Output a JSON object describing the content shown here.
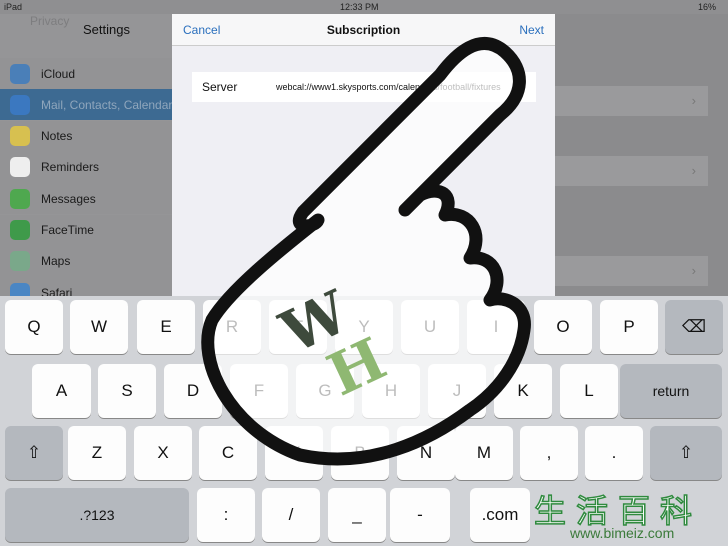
{
  "status": {
    "device": "iPad",
    "time": "12:33 PM",
    "battery": "16%"
  },
  "sidebar": {
    "title": "Settings",
    "ghost": "Privacy",
    "items": [
      {
        "label": "iCloud",
        "color": "#4a7fb8"
      },
      {
        "label": "Mail, Contacts, Calendars",
        "color": "#3b78c0"
      },
      {
        "label": "Notes",
        "color": "#d7c050"
      },
      {
        "label": "Reminders",
        "color": "#eeeeee"
      },
      {
        "label": "Messages",
        "color": "#4fa84f"
      },
      {
        "label": "FaceTime",
        "color": "#3f9a4a"
      },
      {
        "label": "Maps",
        "color": "#7aa88a"
      },
      {
        "label": "Safari",
        "color": "#4a86c4"
      }
    ]
  },
  "modal": {
    "cancel": "Cancel",
    "title": "Subscription",
    "next": "Next",
    "server_label": "Server",
    "server_value": "webcal://www1.skysports.com/calendars/football/fixtures"
  },
  "keyboard": {
    "rows": [
      [
        "Q",
        "W",
        "E",
        "R",
        "T",
        "Y",
        "U",
        "I",
        "O",
        "P",
        "⌫"
      ],
      [
        "A",
        "S",
        "D",
        "F",
        "G",
        "H",
        "J",
        "K",
        "L",
        "return"
      ],
      [
        "⇧",
        "Z",
        "X",
        "C",
        "V",
        "B",
        "N",
        "M",
        ",",
        ".",
        "⇧"
      ],
      [
        ".?123",
        ":",
        "/",
        "_",
        "-",
        ".com"
      ]
    ]
  },
  "overlay": {
    "logo": "WH",
    "watermark_cn": "生活百科",
    "watermark_url": "www.bimeiz.com"
  }
}
